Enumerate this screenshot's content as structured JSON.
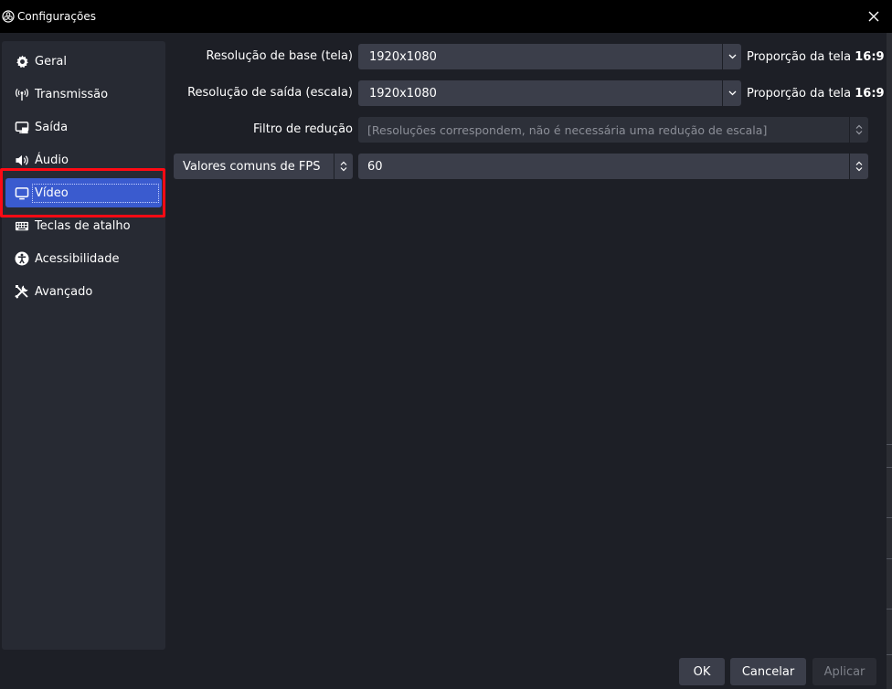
{
  "window": {
    "title": "Configurações"
  },
  "sidebar": {
    "items": [
      {
        "label": "Geral",
        "icon": "gear-icon"
      },
      {
        "label": "Transmissão",
        "icon": "antenna-icon"
      },
      {
        "label": "Saída",
        "icon": "output-icon"
      },
      {
        "label": "Áudio",
        "icon": "speaker-icon"
      },
      {
        "label": "Vídeo",
        "icon": "monitor-icon",
        "active": true
      },
      {
        "label": "Teclas de atalho",
        "icon": "keyboard-icon"
      },
      {
        "label": "Acessibilidade",
        "icon": "accessibility-icon"
      },
      {
        "label": "Avançado",
        "icon": "tools-icon"
      }
    ]
  },
  "video": {
    "base_resolution": {
      "label": "Resolução de base (tela)",
      "value": "1920x1080",
      "ratio_prefix": "Proporção da tela",
      "ratio_value": "16:9"
    },
    "output_resolution": {
      "label": "Resolução de saída (escala)",
      "value": "1920x1080",
      "ratio_prefix": "Proporção da tela",
      "ratio_value": "16:9"
    },
    "downscale_filter": {
      "label": "Filtro de redução",
      "value": "[Resoluções correspondem, não é necessária uma redução de escala]"
    },
    "fps": {
      "type_value": "Valores comuns de FPS",
      "value": "60"
    }
  },
  "buttons": {
    "ok": "OK",
    "cancel": "Cancelar",
    "apply": "Aplicar"
  },
  "colors": {
    "accent": "#3a5bcf",
    "highlight": "#ff0a14",
    "background": "#1d1f26",
    "sidebar": "#272a33"
  }
}
